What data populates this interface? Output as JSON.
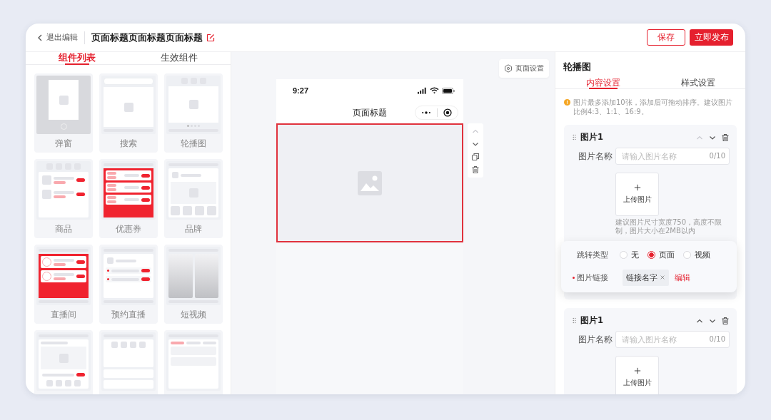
{
  "topbar": {
    "back_label": "退出编辑",
    "title": "页面标题页面标题页面标题",
    "buttons": [
      {
        "label": "保存",
        "kind": "outline"
      },
      {
        "label": "立即发布",
        "kind": "primary"
      }
    ]
  },
  "left_panel": {
    "tabs": [
      {
        "label": "组件列表",
        "selected": true
      },
      {
        "label": "生效组件",
        "selected": false
      }
    ],
    "components": [
      {
        "label": "弹窗",
        "kind": "popup"
      },
      {
        "label": "搜索",
        "kind": "search"
      },
      {
        "label": "轮播图",
        "kind": "carousel"
      },
      {
        "label": "商品",
        "kind": "product"
      },
      {
        "label": "优惠券",
        "kind": "coupon"
      },
      {
        "label": "品牌",
        "kind": "brand"
      },
      {
        "label": "直播间",
        "kind": "live"
      },
      {
        "label": "预约直播",
        "kind": "reserve"
      },
      {
        "label": "短视频",
        "kind": "video"
      },
      {
        "kind": "article"
      },
      {
        "kind": "icons"
      },
      {
        "kind": "tabs"
      }
    ]
  },
  "canvas": {
    "settings_button": "页面设置",
    "phone": {
      "time": "9:27",
      "title": "页面标题",
      "blocks": [
        {
          "kind": "carousel",
          "selected": true
        }
      ]
    },
    "block_toolbar": [
      {
        "kind": "up",
        "disabled": true
      },
      {
        "kind": "down",
        "disabled": false
      },
      {
        "kind": "copy",
        "disabled": false
      },
      {
        "kind": "delete",
        "disabled": false
      }
    ]
  },
  "right_panel": {
    "title": "轮播图",
    "tabs": [
      {
        "label": "内容设置",
        "selected": true
      },
      {
        "label": "样式设置",
        "selected": false
      }
    ],
    "notice": "图片最多添加10张，添加后可拖动排序。建议图片比例4:3、1:1、16:9。",
    "items": [
      {
        "title": "图片1",
        "up_disabled": true,
        "down_disabled": false,
        "name_label": "图片名称",
        "name_placeholder": "请输入图片名称",
        "name_counter": "0/10",
        "upload_label": "上传图片",
        "upload_hint": "建议图片尺寸宽度750，高度不限制，图片大小在2MB以内",
        "link_popup": {
          "jump_label": "跳转类型",
          "options": [
            {
              "label": "无",
              "selected": false
            },
            {
              "label": "页面",
              "selected": true
            },
            {
              "label": "视频",
              "selected": false
            }
          ],
          "link_label": "图片链接",
          "required": true,
          "link_tag": "链接名字",
          "edit_link": "编辑"
        }
      },
      {
        "title": "图片1",
        "up_disabled": false,
        "down_disabled": false,
        "name_label": "图片名称",
        "name_placeholder": "请输入图片名称",
        "name_counter": "0/10",
        "upload_label": "上传图片"
      }
    ]
  }
}
